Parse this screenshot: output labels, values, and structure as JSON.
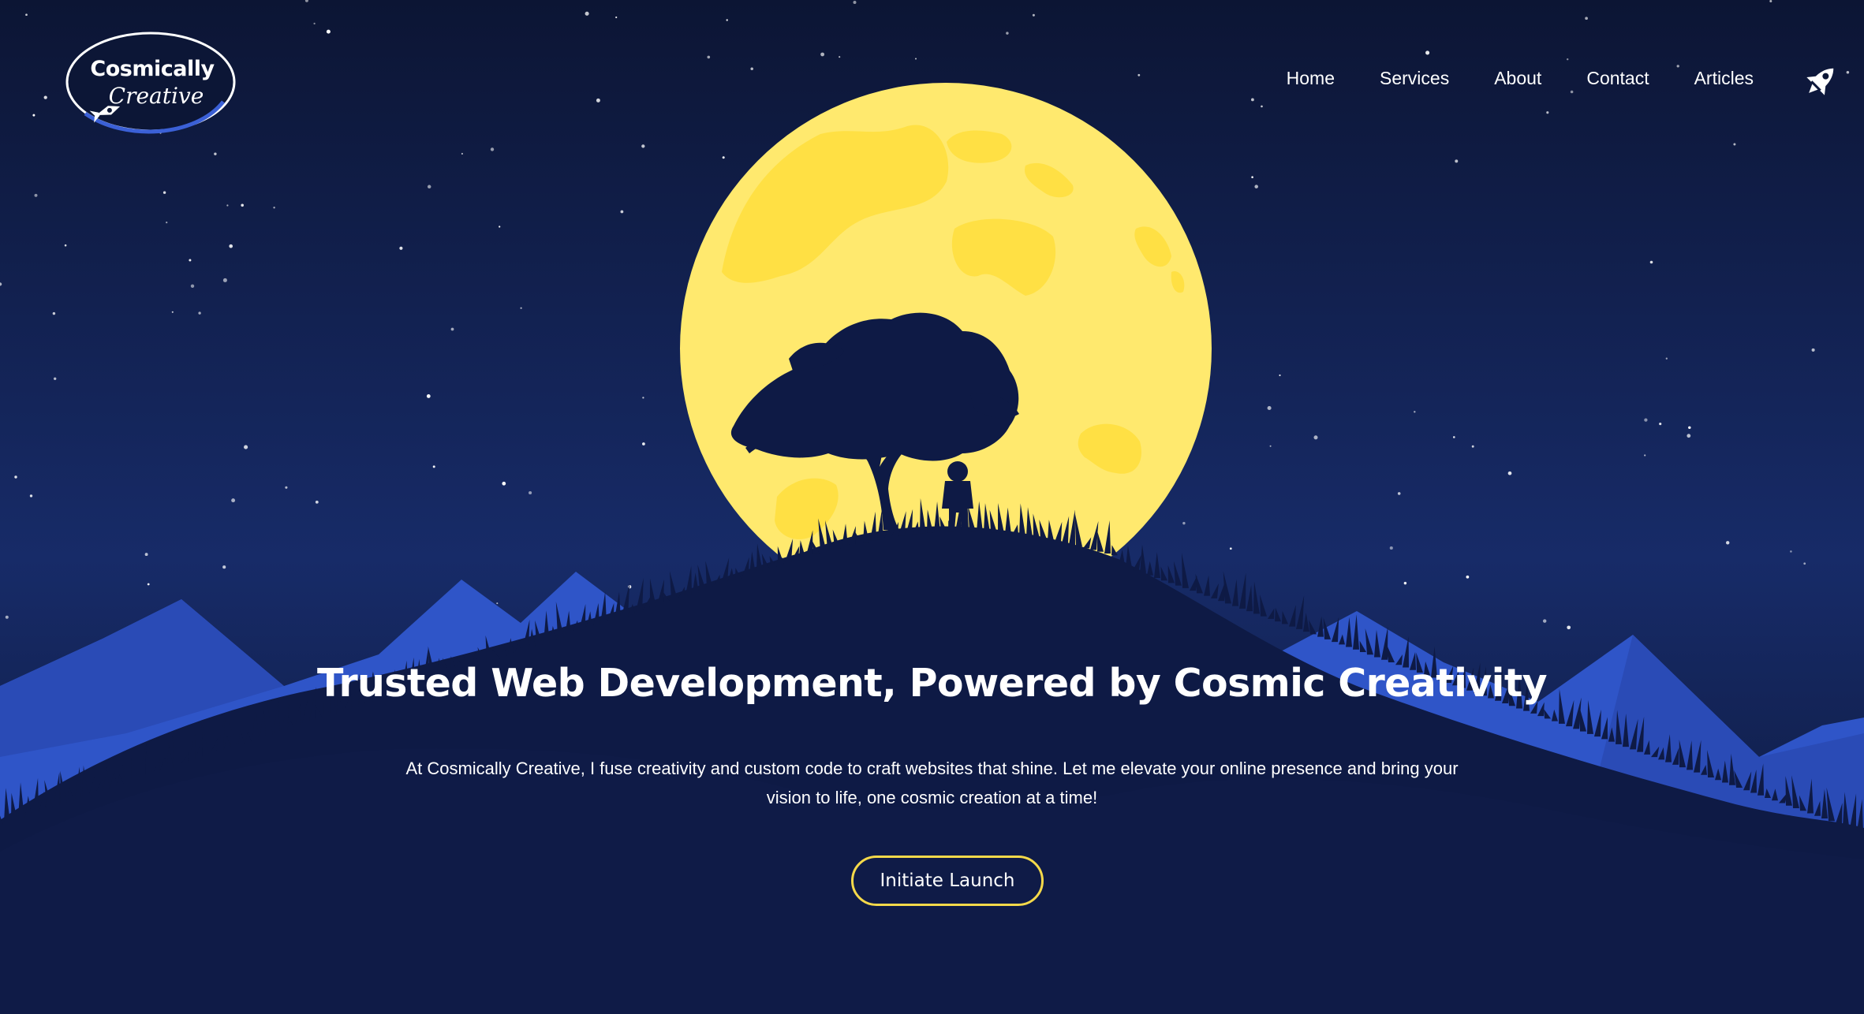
{
  "brand": {
    "name": "Cosmically",
    "subname": "Creative"
  },
  "nav": {
    "items": [
      {
        "label": "Home"
      },
      {
        "label": "Services"
      },
      {
        "label": "About"
      },
      {
        "label": "Contact"
      },
      {
        "label": "Articles"
      }
    ],
    "rocket_icon": "rocket-icon"
  },
  "hero": {
    "title": "Trusted Web Development, Powered by Cosmic Creativity",
    "text": "At Cosmically Creative, I fuse creativity and custom code to craft websites that shine. Let me elevate your online presence and bring your vision to life, one cosmic creation at a time!",
    "cta_label": "Initiate Launch"
  },
  "colors": {
    "sky": "#0c1636",
    "moon": "#ffe96e",
    "mountains": "#2f55c8",
    "accent": "#f5d94a"
  }
}
